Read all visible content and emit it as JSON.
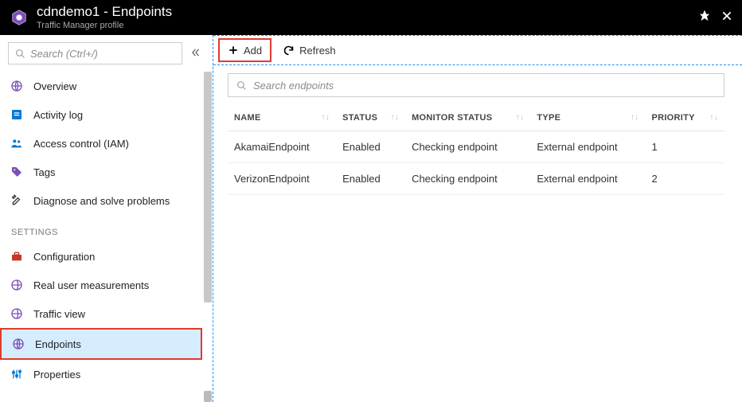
{
  "header": {
    "title": "cdndemo1 - Endpoints",
    "subtitle": "Traffic Manager profile"
  },
  "sidebar": {
    "search_placeholder": "Search (Ctrl+/)",
    "sections": {
      "settings_label": "SETTINGS"
    },
    "items": [
      {
        "label": "Overview"
      },
      {
        "label": "Activity log"
      },
      {
        "label": "Access control (IAM)"
      },
      {
        "label": "Tags"
      },
      {
        "label": "Diagnose and solve problems"
      },
      {
        "label": "Configuration"
      },
      {
        "label": "Real user measurements"
      },
      {
        "label": "Traffic view"
      },
      {
        "label": "Endpoints"
      },
      {
        "label": "Properties"
      }
    ]
  },
  "toolbar": {
    "add_label": "Add",
    "refresh_label": "Refresh"
  },
  "main": {
    "search_placeholder": "Search endpoints",
    "columns": {
      "name": "NAME",
      "status": "STATUS",
      "monitor": "MONITOR STATUS",
      "type": "TYPE",
      "priority": "PRIORITY"
    },
    "rows": [
      {
        "name": "AkamaiEndpoint",
        "status": "Enabled",
        "monitor": "Checking endpoint",
        "type": "External endpoint",
        "priority": "1"
      },
      {
        "name": "VerizonEndpoint",
        "status": "Enabled",
        "monitor": "Checking endpoint",
        "type": "External endpoint",
        "priority": "2"
      }
    ]
  }
}
